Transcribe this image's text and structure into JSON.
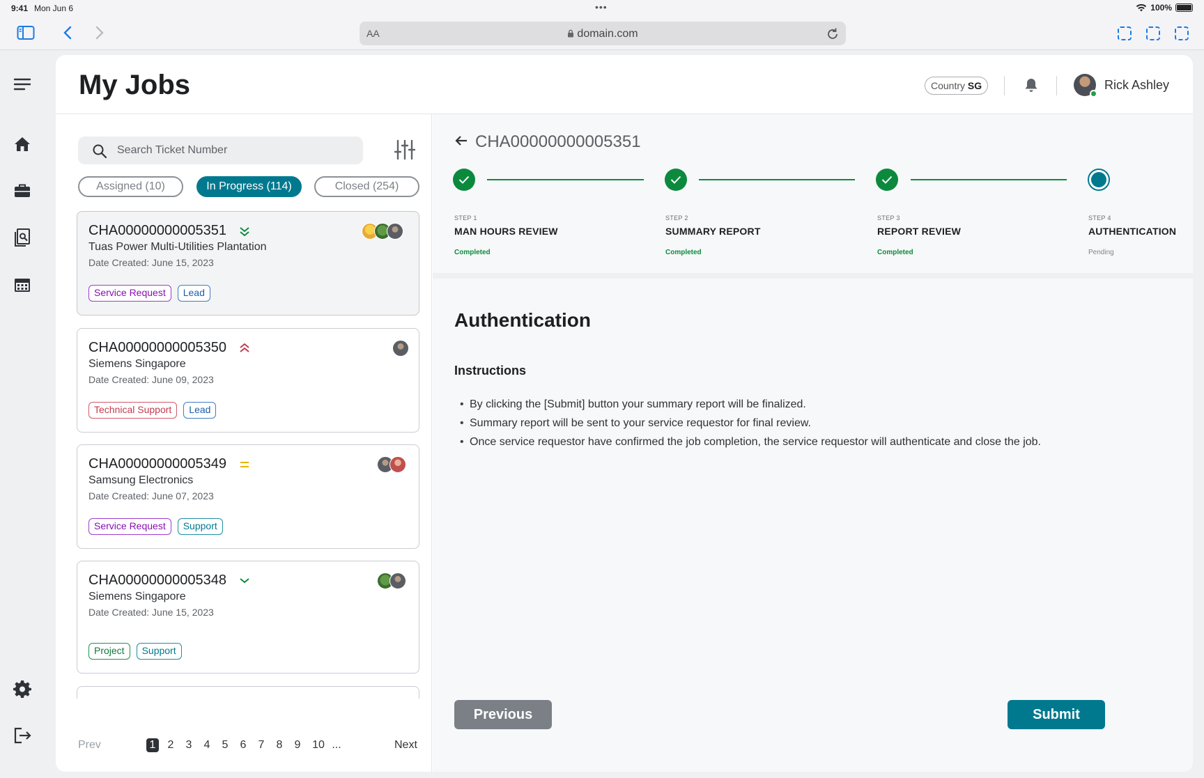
{
  "status_bar": {
    "time": "9:41",
    "date": "Mon Jun 6",
    "battery": "100%"
  },
  "browser": {
    "text_size": "AA",
    "url": "domain.com"
  },
  "header": {
    "title": "My Jobs",
    "country_label": "Country",
    "country_code": "SG",
    "user_name": "Rick Ashley"
  },
  "search": {
    "placeholder": "Search Ticket Number",
    "value": ""
  },
  "tabs": [
    {
      "label": "Assigned (10)",
      "active": false
    },
    {
      "label": "In Progress (114)",
      "active": true
    },
    {
      "label": "Closed (254)",
      "active": false
    }
  ],
  "jobs": [
    {
      "id": "CHA00000000005351",
      "company": "Tuas Power Multi-Utilities Plantation",
      "date": "Date Created: June 15, 2023",
      "priority": "double-chevron-down",
      "tags": [
        "Service Request",
        "Lead"
      ],
      "avatars": [
        "yellow",
        "frog",
        "gray"
      ]
    },
    {
      "id": "CHA00000000005350",
      "company": "Siemens Singapore",
      "date": "Date Created: June 09, 2023",
      "priority": "double-chevron-up",
      "tags": [
        "Technical Support",
        "Lead"
      ],
      "avatars": [
        "gray"
      ]
    },
    {
      "id": "CHA00000000005349",
      "company": "Samsung Electronics",
      "date": "Date Created: June 07, 2023",
      "priority": "equal",
      "tags": [
        "Service Request",
        "Support"
      ],
      "avatars": [
        "gray",
        "red"
      ]
    },
    {
      "id": "CHA00000000005348",
      "company": "Siemens Singapore",
      "date": "Date Created: June 15, 2023",
      "priority": "chevron-down",
      "tags": [
        "Project",
        "Support"
      ],
      "avatars": [
        "frog",
        "gray"
      ]
    }
  ],
  "pagination": {
    "prev": "Prev",
    "next": "Next",
    "pages": [
      "1",
      "2",
      "3",
      "4",
      "5",
      "6",
      "7",
      "8",
      "9",
      "10",
      "..."
    ],
    "current": "1"
  },
  "detail": {
    "ticket_id": "CHA00000000005351",
    "steps": [
      {
        "step": "STEP 1",
        "title": "MAN HOURS REVIEW",
        "status": "Completed"
      },
      {
        "step": "STEP 2",
        "title": "SUMMARY REPORT",
        "status": "Completed"
      },
      {
        "step": "STEP 3",
        "title": "REPORT REVIEW",
        "status": "Completed"
      },
      {
        "step": "STEP 4",
        "title": "AUTHENTICATION",
        "status": "Pending"
      }
    ],
    "section_title": "Authentication",
    "instructions_label": "Instructions",
    "instructions": [
      "By clicking the [Submit] button your summary report will be finalized.",
      "Summary report will be sent to your service requestor for final review.",
      "Once service requestor have confirmed the job completion, the service requestor will authenticate and close the job."
    ],
    "previous_label": "Previous",
    "submit_label": "Submit"
  },
  "colors": {
    "accent": "#00798f",
    "success": "#0b8a3e",
    "tag_purple": "#8a0eb3",
    "tag_blue": "#1b5ea8",
    "tag_red": "#c03b4d",
    "tag_teal": "#00798f",
    "tag_green": "#0e7a3a"
  },
  "icons": [
    "menu-icon",
    "home-icon",
    "briefcase-icon",
    "document-search-icon",
    "calendar-icon",
    "settings-icon",
    "logout-icon",
    "bell-icon",
    "search-icon",
    "filter-icon",
    "back-arrow-icon",
    "check-icon"
  ]
}
